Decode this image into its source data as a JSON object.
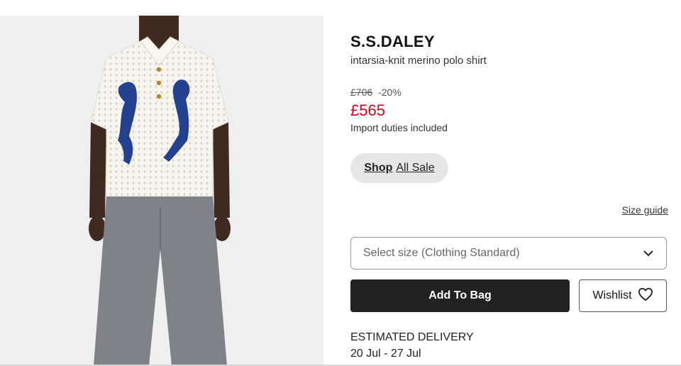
{
  "product": {
    "brand": "S.S.DALEY",
    "name": "intarsia-knit merino polo shirt",
    "original_price": "£706",
    "discount": "-20%",
    "sale_price": "£565",
    "duties_note": "Import duties included"
  },
  "shop_link": {
    "strong_label": "Shop",
    "light_label": "All Sale"
  },
  "size_guide_label": "Size guide",
  "size_select": {
    "placeholder": "Select size (Clothing Standard)"
  },
  "actions": {
    "add_to_bag_label": "Add To Bag",
    "wishlist_label": "Wishlist"
  },
  "delivery": {
    "title": "ESTIMATED DELIVERY",
    "dates": "20 Jul - 27 Jul"
  },
  "colors": {
    "sale_red": "#d0021b",
    "primary_button": "#222222",
    "pill_bg": "#e6e6e6",
    "shirt_motif_blue": "#23418f"
  },
  "icons": {
    "size_dropdown": "chevron-down-icon",
    "wishlist": "heart-icon"
  }
}
